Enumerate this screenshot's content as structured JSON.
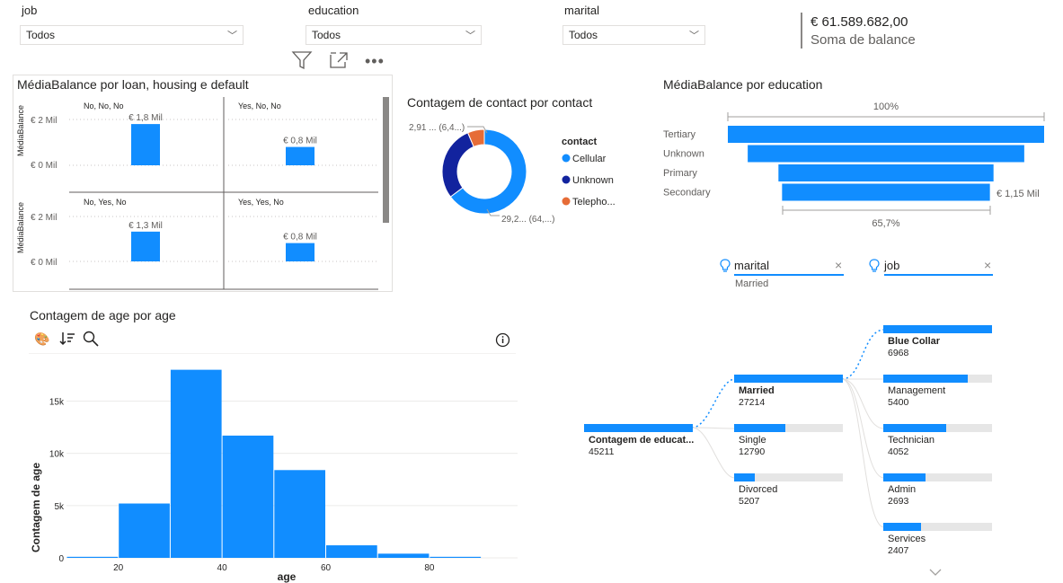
{
  "slicers": [
    {
      "label": "job",
      "value": "Todos"
    },
    {
      "label": "education",
      "value": "Todos"
    },
    {
      "label": "marital",
      "value": "Todos"
    }
  ],
  "card": {
    "value": "€ 61.589.682,00",
    "label": "Soma de balance"
  },
  "small_multiples": {
    "title": "MédiaBalance por loan, housing e default",
    "y_axis_label": "MédiaBalance",
    "panels": [
      {
        "title": "No, No, No",
        "value_label": "€ 1,8 Mil",
        "value": 1.8
      },
      {
        "title": "Yes, No, No",
        "value_label": "€ 0,8 Mil",
        "value": 0.8
      },
      {
        "title": "No, Yes, No",
        "value_label": "€ 1,3 Mil",
        "value": 1.3
      },
      {
        "title": "Yes, Yes, No",
        "value_label": "€ 0,8 Mil",
        "value": 0.8
      }
    ],
    "y_ticks": [
      "€ 2 Mil",
      "€ 0 Mil"
    ]
  },
  "donut": {
    "title": "Contagem de contact por contact",
    "legend_title": "contact",
    "legend": [
      {
        "name": "Cellular",
        "color": "#118dff"
      },
      {
        "name": "Unknown",
        "color": "#12239e"
      },
      {
        "name": "Telepho...",
        "color": "#e66c37"
      }
    ],
    "label_small": "2,91 ... (6,4...)",
    "label_large": "29,2... (64,...)"
  },
  "funnel": {
    "title": "MédiaBalance por education",
    "top_pct": "100%",
    "bottom_pct": "65,7%",
    "last_value": "€ 1,15 Mil",
    "categories": [
      "Tertiary",
      "Unknown",
      "Primary",
      "Secondary"
    ],
    "values": [
      1.75,
      1.53,
      1.19,
      1.15
    ]
  },
  "histogram": {
    "title": "Contagem de age por age",
    "x_label": "age",
    "y_label": "Contagem de age",
    "x_ticks": [
      "20",
      "40",
      "60",
      "80"
    ],
    "y_ticks": [
      "0",
      "5k",
      "10k",
      "15k"
    ]
  },
  "chart_data": {
    "type": "bar",
    "title": "Contagem de age por age",
    "xlabel": "age",
    "ylabel": "Contagem de age",
    "bins": [
      [
        10,
        20
      ],
      [
        20,
        30
      ],
      [
        30,
        40
      ],
      [
        40,
        50
      ],
      [
        50,
        60
      ],
      [
        60,
        70
      ],
      [
        70,
        80
      ],
      [
        80,
        90
      ]
    ],
    "values": [
      100,
      5200,
      18000,
      11700,
      8400,
      1200,
      400,
      100
    ],
    "xlim": [
      10,
      97
    ],
    "ylim": [
      0,
      19000
    ]
  },
  "decomp_tree": {
    "filters": [
      {
        "label": "marital",
        "value": "Married"
      },
      {
        "label": "job",
        "value": ""
      }
    ],
    "root": {
      "label": "Contagem de educat...",
      "value": "45211"
    },
    "level1": [
      {
        "label": "Married",
        "value": "27214",
        "frac": 1.0,
        "bold": true
      },
      {
        "label": "Single",
        "value": "12790",
        "frac": 0.47,
        "bold": false
      },
      {
        "label": "Divorced",
        "value": "5207",
        "frac": 0.19,
        "bold": false
      }
    ],
    "level2": [
      {
        "label": "Blue Collar",
        "value": "6968",
        "frac": 1.0,
        "bold": true
      },
      {
        "label": "Management",
        "value": "5400",
        "frac": 0.775,
        "bold": false
      },
      {
        "label": "Technician",
        "value": "4052",
        "frac": 0.58,
        "bold": false
      },
      {
        "label": "Admin",
        "value": "2693",
        "frac": 0.39,
        "bold": false
      },
      {
        "label": "Services",
        "value": "2407",
        "frac": 0.345,
        "bold": false
      }
    ]
  }
}
